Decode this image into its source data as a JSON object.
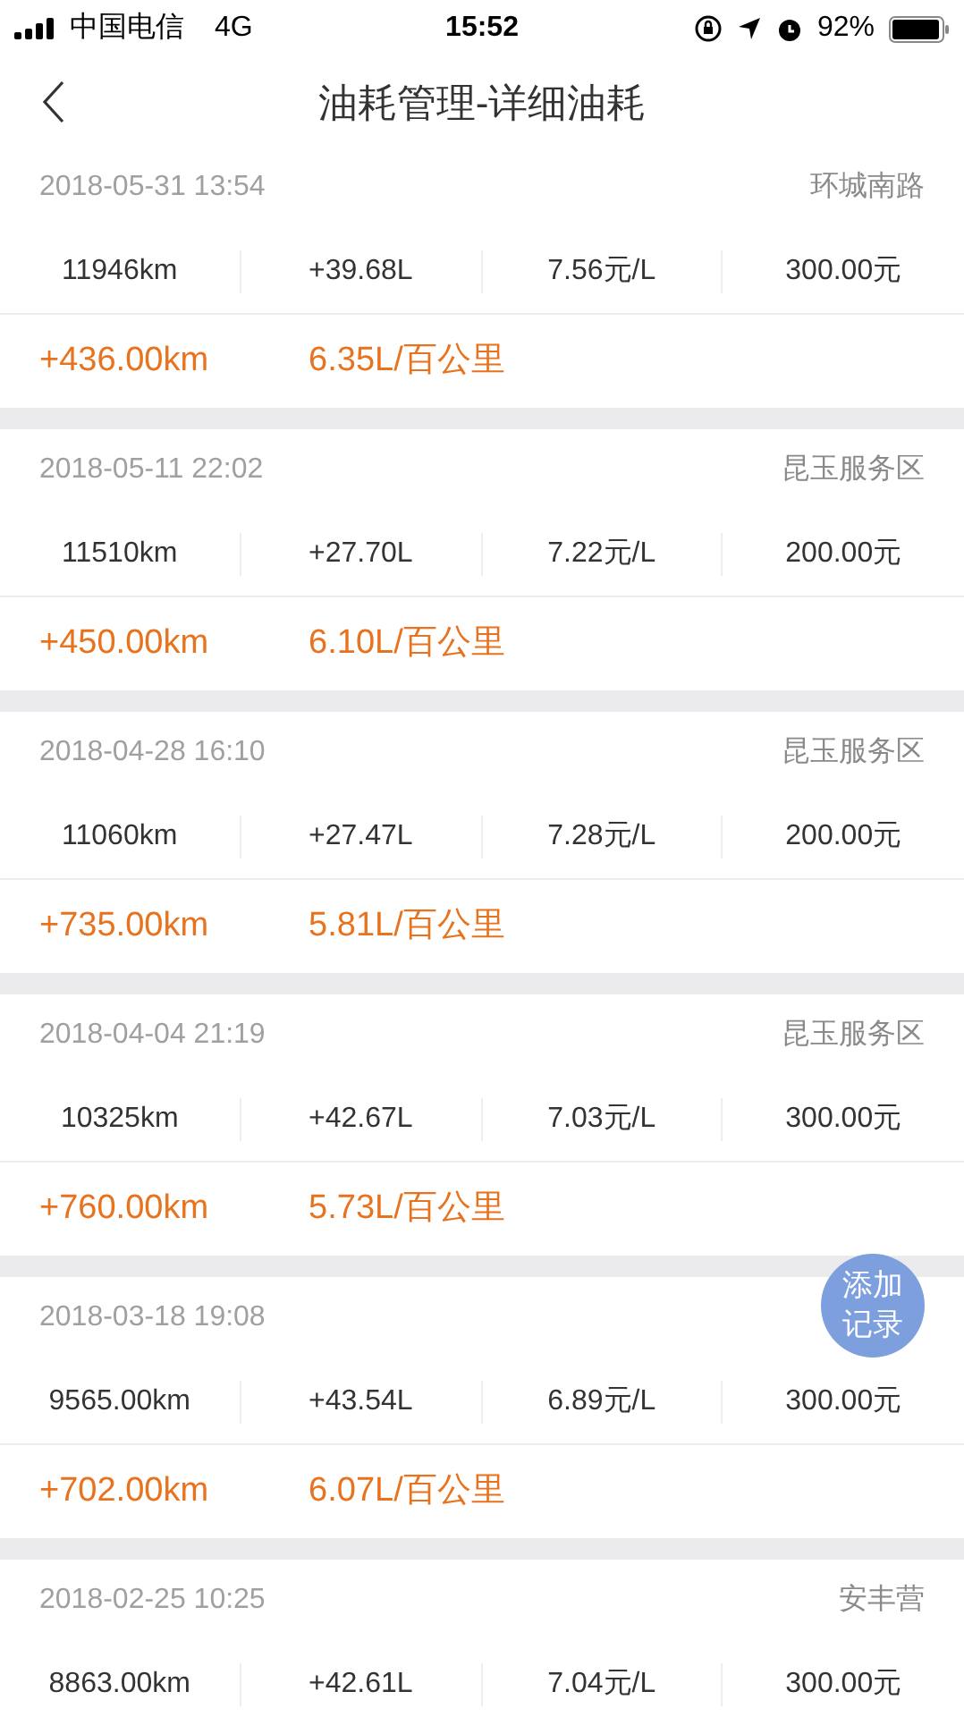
{
  "status_bar": {
    "carrier": "中国电信",
    "network": "4G",
    "time": "15:52",
    "battery": "92%"
  },
  "nav": {
    "title": "油耗管理-详细油耗"
  },
  "records": [
    {
      "datetime": "2018-05-31 13:54",
      "location": "环城南路",
      "odometer": "11946km",
      "fuel": "+39.68L",
      "price": "7.56元/L",
      "amount": "300.00元",
      "distance": "+436.00km",
      "consumption": "6.35L/百公里"
    },
    {
      "datetime": "2018-05-11 22:02",
      "location": "昆玉服务区",
      "odometer": "11510km",
      "fuel": "+27.70L",
      "price": "7.22元/L",
      "amount": "200.00元",
      "distance": "+450.00km",
      "consumption": "6.10L/百公里"
    },
    {
      "datetime": "2018-04-28 16:10",
      "location": "昆玉服务区",
      "odometer": "11060km",
      "fuel": "+27.47L",
      "price": "7.28元/L",
      "amount": "200.00元",
      "distance": "+735.00km",
      "consumption": "5.81L/百公里"
    },
    {
      "datetime": "2018-04-04 21:19",
      "location": "昆玉服务区",
      "odometer": "10325km",
      "fuel": "+42.67L",
      "price": "7.03元/L",
      "amount": "300.00元",
      "distance": "+760.00km",
      "consumption": "5.73L/百公里"
    },
    {
      "datetime": "2018-03-18 19:08",
      "odometer": "9565.00km",
      "fuel": "+43.54L",
      "price": "6.89元/L",
      "amount": "300.00元",
      "distance": "+702.00km",
      "consumption": "6.07L/百公里"
    },
    {
      "datetime": "2018-02-25 10:25",
      "location": "安丰营",
      "odometer": "8863.00km",
      "fuel": "+42.61L",
      "price": "7.04元/L",
      "amount": "300.00元"
    }
  ],
  "fab": {
    "label": "添加记录"
  }
}
